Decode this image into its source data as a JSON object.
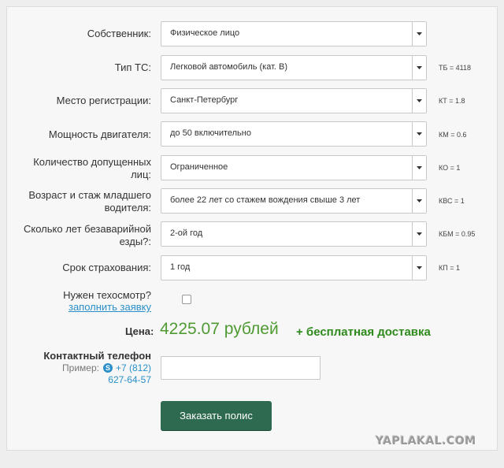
{
  "form": {
    "fields": [
      {
        "label_lines": [
          "Собственник:"
        ],
        "value": "Физическое лицо",
        "coef": ""
      },
      {
        "label_lines": [
          "Тип ТС:"
        ],
        "value": "Легковой автомобиль (кат. В)",
        "coef": "ТБ = 4118"
      },
      {
        "label_lines": [
          "Место регистрации:"
        ],
        "value": "Санкт-Петербург",
        "coef": "КТ = 1.8"
      },
      {
        "label_lines": [
          "Мощность двигателя:"
        ],
        "value": "до 50 включительно",
        "coef": "КМ = 0.6"
      },
      {
        "label_lines": [
          "Количество допущенных",
          "лиц:"
        ],
        "value": "Ограниченное",
        "coef": "КО = 1"
      },
      {
        "label_lines": [
          "Возраст и стаж младшего",
          "водителя:"
        ],
        "value": "более 22 лет со стажем вождения свыше 3 лет",
        "coef": "КВС = 1"
      },
      {
        "label_lines": [
          "Сколько лет безаварийной",
          "езды?:"
        ],
        "value": "2-ой год",
        "coef": "КБМ = 0.95"
      },
      {
        "label_lines": [
          "Срок страхования:"
        ],
        "value": "1 год",
        "coef": "КП = 1"
      }
    ],
    "inspection": {
      "question": "Нужен техосмотр?",
      "link": "заполнить заявку",
      "checked": false
    },
    "price": {
      "label": "Цена:",
      "value": "4225.07 рублей",
      "delivery": "+ бесплатная доставка"
    },
    "contact": {
      "title": "Контактный телефон",
      "example_label": "Пример:",
      "phone_part1": "+7 (812)",
      "phone_part2": "627-64-57",
      "input_value": ""
    },
    "order_button": "Заказать полис"
  },
  "watermark": "YAPLAKAL.COM",
  "colors": {
    "price": "#4f9a33",
    "delivery": "#2e8a1c",
    "button": "#2d6a4f",
    "link": "#2a8fc8"
  }
}
